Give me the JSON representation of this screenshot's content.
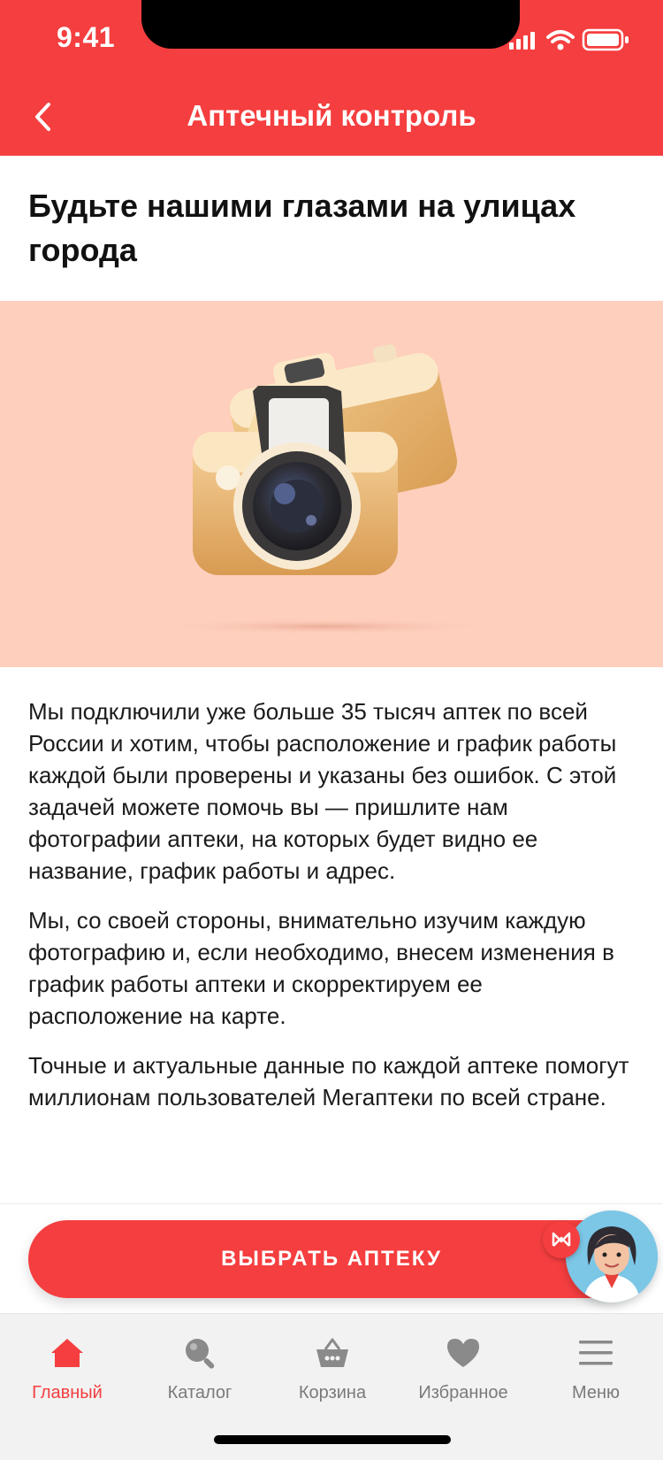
{
  "status_bar": {
    "time": "9:41"
  },
  "header": {
    "title": "Аптечный контроль"
  },
  "content": {
    "heading": "Будьте нашими глазами на улицах города",
    "paragraphs": [
      "Мы подключили уже больше 35 тысяч аптек по всей России и хотим, чтобы расположение и график работы каждой были проверены и указаны без ошибок. С этой задачей можете помочь вы — пришлите нам фотографии аптеки, на которых будет видно ее название, график работы и адрес.",
      "Мы, со своей стороны, внимательно изучим каждую фотографию и, если необходимо, внесем изменения в график работы аптеки и скорректируем ее расположение на карте.",
      "Точные и актуальные данные по каждой аптеке помогут миллионам пользователей Мегаптеки по всей стране."
    ]
  },
  "cta": {
    "label": "ВЫБРАТЬ АПТЕКУ"
  },
  "tabbar": {
    "items": [
      {
        "label": "Главный",
        "icon": "home-icon",
        "active": true
      },
      {
        "label": "Каталог",
        "icon": "search-icon",
        "active": false
      },
      {
        "label": "Корзина",
        "icon": "basket-icon",
        "active": false
      },
      {
        "label": "Избранное",
        "icon": "heart-icon",
        "active": false
      },
      {
        "label": "Меню",
        "icon": "menu-icon",
        "active": false
      }
    ]
  },
  "colors": {
    "accent": "#f53e3f",
    "hero_bg": "#fecfbd",
    "tab_inactive": "#7a7a7a"
  }
}
